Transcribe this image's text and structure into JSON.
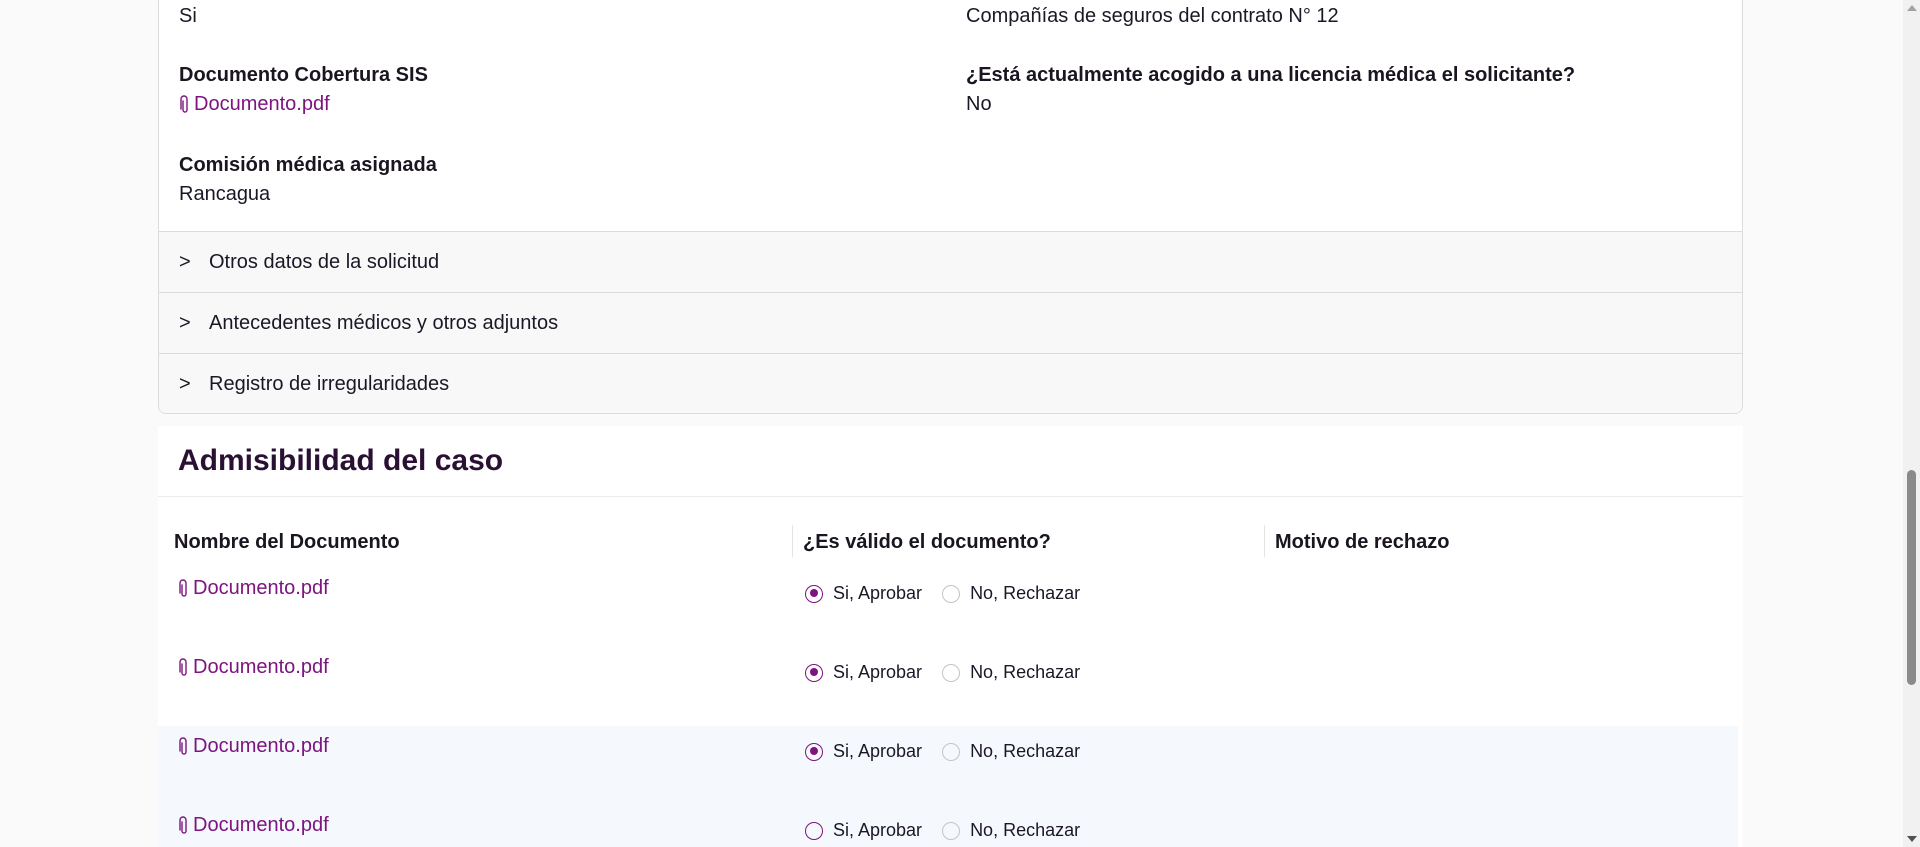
{
  "details": {
    "row0": {
      "left_value": "Si",
      "right_value": "Compañías de seguros del contrato N° 12"
    },
    "doc_cobertura": {
      "label": "Documento Cobertura SIS",
      "link": "Documento.pdf"
    },
    "licencia": {
      "label": "¿Está actualmente acogido a una licencia médica el solicitante?",
      "value": "No"
    },
    "comision": {
      "label": "Comisión médica asignada",
      "value": "Rancagua"
    }
  },
  "accordions": [
    {
      "chevron": ">",
      "label": "Otros datos de la solicitud"
    },
    {
      "chevron": ">",
      "label": "Antecedentes médicos y otros adjuntos"
    },
    {
      "chevron": ">",
      "label": "Registro de irregularidades"
    }
  ],
  "admisibilidad": {
    "title": "Admisibilidad del caso",
    "headers": [
      "Nombre del Documento",
      "¿Es válido el documento?",
      "Motivo de rechazo"
    ],
    "approve_label": "Si, Aprobar",
    "reject_label": "No, Rechazar",
    "rows": [
      {
        "document": "Documento.pdf",
        "selected": "approve",
        "motivo": ""
      },
      {
        "document": "Documento.pdf",
        "selected": "approve",
        "motivo": ""
      },
      {
        "document": "Documento.pdf",
        "selected": "approve",
        "motivo": ""
      },
      {
        "document": "Documento.pdf",
        "selected": "none",
        "motivo": ""
      }
    ]
  },
  "colors": {
    "accent": "#7d1480",
    "heading": "#2a1033",
    "row_alt": "#f5f8fd"
  }
}
